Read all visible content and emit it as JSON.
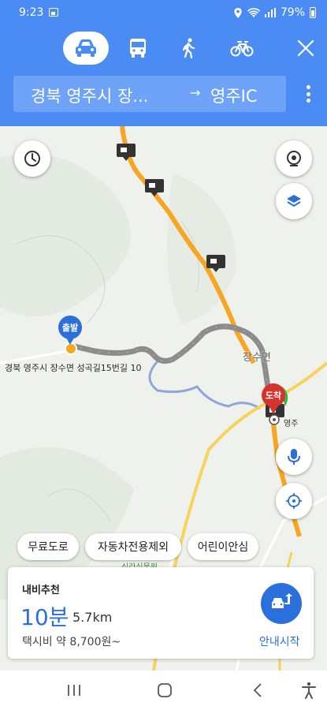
{
  "status_bar": {
    "time": "9:23",
    "battery": "79%"
  },
  "modes": {
    "active": "car",
    "items": [
      "car",
      "bus",
      "walk",
      "bike"
    ]
  },
  "route": {
    "from": "경북 영주시 장...",
    "arrow": "→",
    "to": "영주IC"
  },
  "map": {
    "origin_pin": "출발",
    "destination_pin": "도착",
    "origin_address": "경북 영주시 장수면 성곡길15번길 10",
    "town_label": "장수면",
    "poi_label": "신라식물원",
    "ic_label": "영주"
  },
  "filters": [
    "무료도로",
    "자동차전용제외",
    "어린이안심"
  ],
  "summary": {
    "recommended_label": "내비추천",
    "duration": "10분",
    "distance": "5.7km",
    "taxi_fare": "택시비 약 8,700원~",
    "start_nav_label": "안내시작"
  },
  "colors": {
    "header_blue": "#4a8cf4",
    "accent_blue": "#2a6fdb",
    "route_gray": "#8c8c8c",
    "highway_orange": "#f6a623",
    "dest_red": "#d6332f"
  }
}
